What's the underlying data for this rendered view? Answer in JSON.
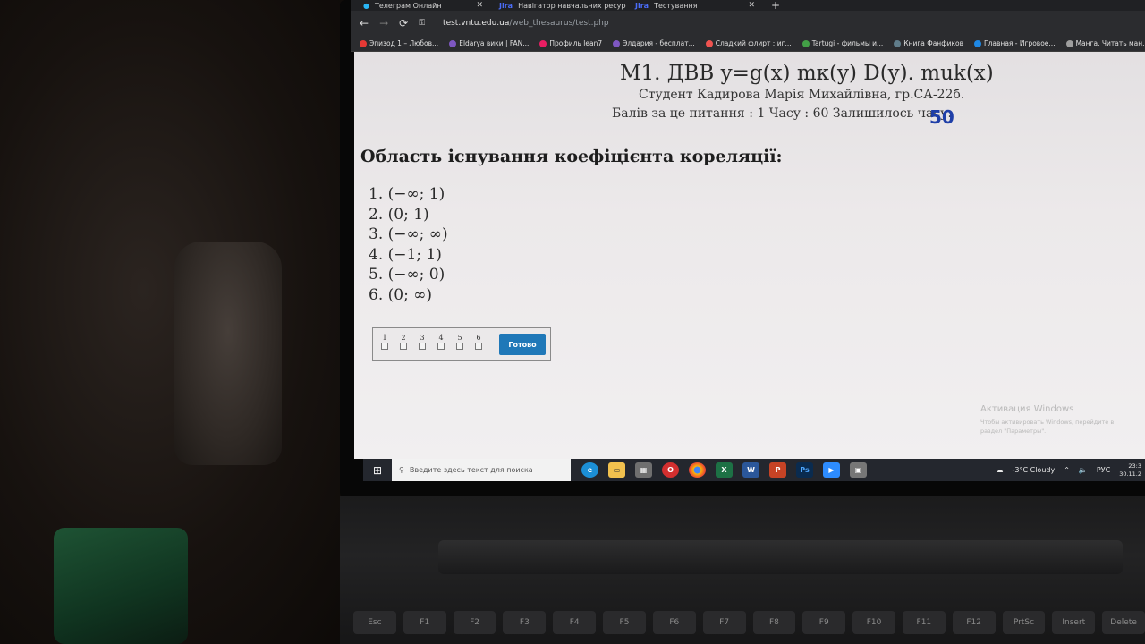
{
  "browser": {
    "tabs": [
      {
        "label": "Телеграм Онлайн",
        "icon": "telegram-icon"
      },
      {
        "label": "Навігатор навчальних ресурсів",
        "icon": "jira-icon"
      },
      {
        "label": "Тестування",
        "icon": "jira-icon"
      }
    ],
    "new_tab": "+",
    "url_domain": "test.vntu.edu.ua",
    "url_path": "/web_thesaurus/test.php",
    "bookmarks": [
      {
        "label": "Эпизод 1 – Любов...",
        "color": "#e53935"
      },
      {
        "label": "Eldarya вики | FAN...",
        "color": "#7e57c2"
      },
      {
        "label": "Профиль lean7",
        "color": "#e91e63"
      },
      {
        "label": "Элдария - бесплат...",
        "color": "#7e57c2"
      },
      {
        "label": "Сладкий флирт : иг...",
        "color": "#ef5350"
      },
      {
        "label": "Tartugi - фильмы и...",
        "color": "#43a047"
      },
      {
        "label": "Книга Фанфиков",
        "color": "#607d8b"
      },
      {
        "label": "Главная - Игровое...",
        "color": "#1e88e5"
      },
      {
        "label": "Манга. Читать ман...",
        "color": "#9e9e9e"
      }
    ]
  },
  "test": {
    "title": "М1. ДВВ y=g(x) mк(y) D(y). muk(x)",
    "student": "Студент Кадирова Марія Михайлівна, гр.СА-22б.",
    "points_line": "Балів за це питання : 1 Часу : 60 Залишилось часу:",
    "time_left": "50",
    "question": "Область існування коефіцієнта кореляції:",
    "options": [
      "1. (−∞; 1)",
      "2. (0; 1)",
      "3. (−∞; ∞)",
      "4. (−1; 1)",
      "5. (−∞; 0)",
      "6. (0; ∞)"
    ],
    "checkbox_labels": [
      "1",
      "2",
      "3",
      "4",
      "5",
      "6"
    ],
    "submit_label": "Готово"
  },
  "watermark": {
    "title": "Активация Windows",
    "subtitle": "Чтобы активировать Windows, перейдите в раздел \"Параметры\"."
  },
  "taskbar": {
    "search_placeholder": "Введите здесь текст для поиска",
    "weather": "-3°C Cloudy",
    "language": "РУС",
    "time": "23:3",
    "date": "30.11.2"
  },
  "keyboard": [
    "Esc",
    "F1",
    "F2",
    "F3",
    "F4",
    "F5",
    "F6",
    "F7",
    "F8",
    "F9",
    "F10",
    "F11",
    "F12",
    "PrtSc",
    "Insert",
    "Delete"
  ]
}
